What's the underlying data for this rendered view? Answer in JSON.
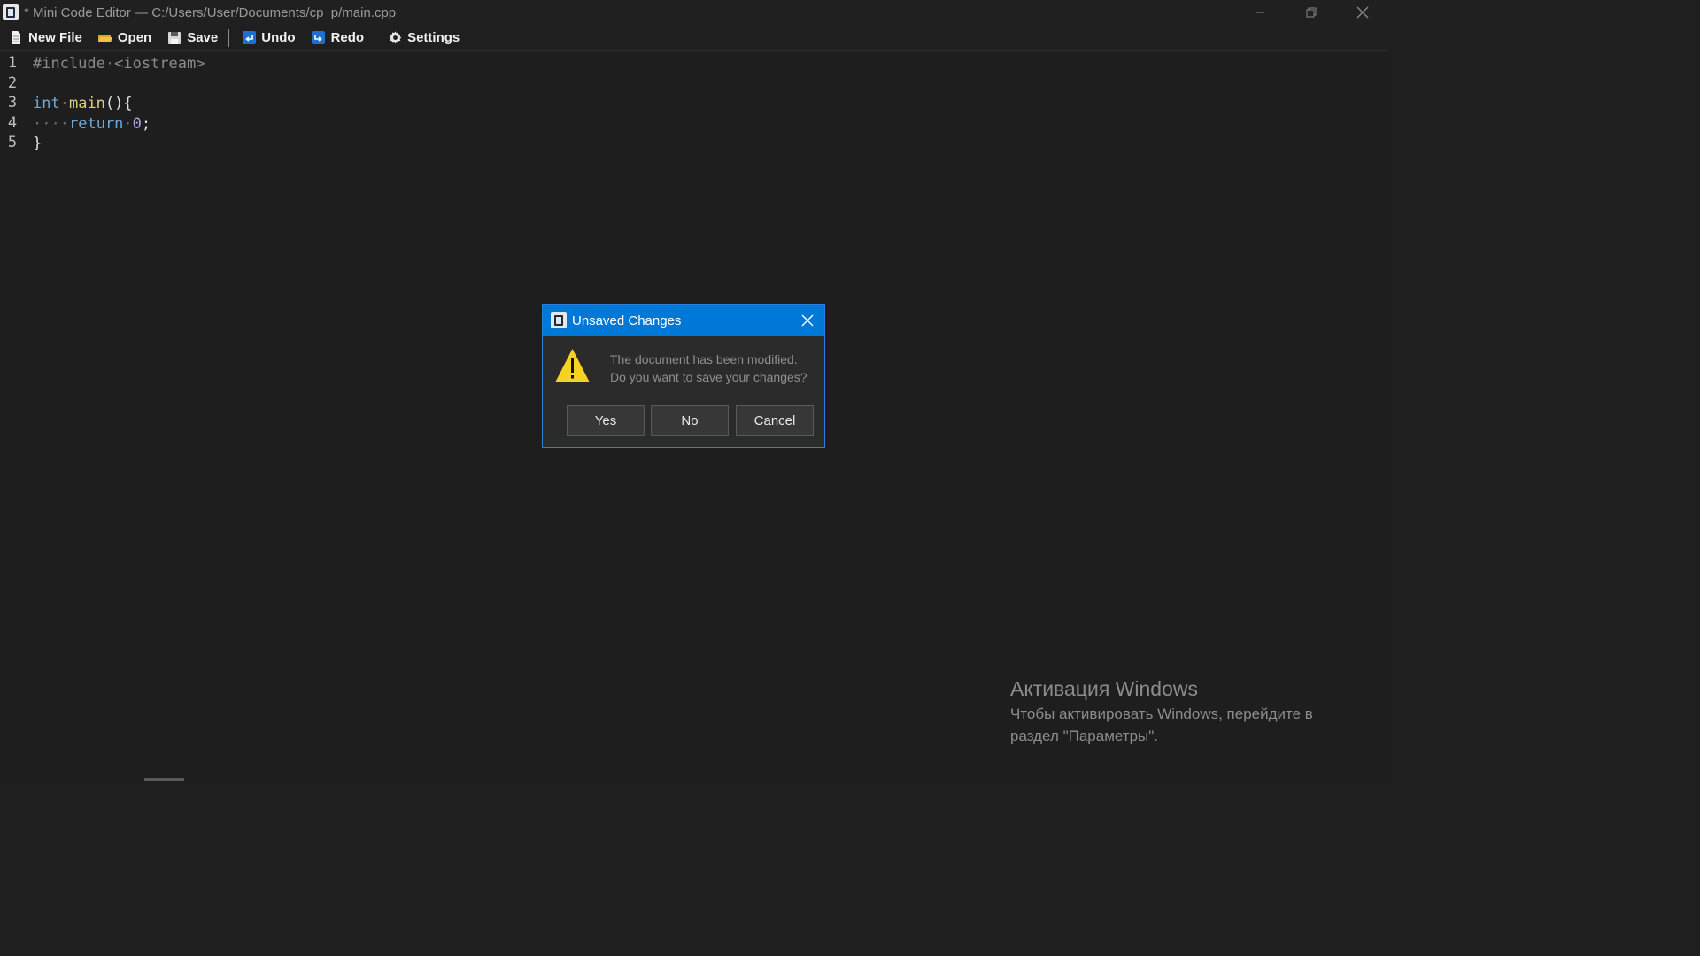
{
  "window": {
    "title": "* Mini Code Editor — C:/Users/User/Documents/cp_p/main.cpp",
    "controls": [
      "minimize",
      "restore",
      "close"
    ]
  },
  "toolbar": {
    "new_file": "New File",
    "open": "Open",
    "save": "Save",
    "undo": "Undo",
    "redo": "Redo",
    "settings": "Settings"
  },
  "editor": {
    "line_numbers": [
      "1",
      "2",
      "3",
      "4",
      "5"
    ],
    "lines": [
      "#include <iostream>",
      "",
      "int main(){",
      "    return 0;",
      "}"
    ],
    "whitespace_visible": true
  },
  "dialog": {
    "title": "Unsaved Changes",
    "message_line1": "The document has been modified.",
    "message_line2": "Do you want to save your changes?",
    "yes": "Yes",
    "no": "No",
    "cancel": "Cancel",
    "icon": "warning-icon"
  },
  "activation": {
    "title": "Активация Windows",
    "text": "Чтобы активировать Windows, перейдите в раздел \"Параметры\"."
  },
  "colors": {
    "accent": "#0078d7",
    "background": "#1e1e1e",
    "keyword": "#6ea9d8",
    "function": "#d7d27b",
    "number": "#b09fe0"
  }
}
